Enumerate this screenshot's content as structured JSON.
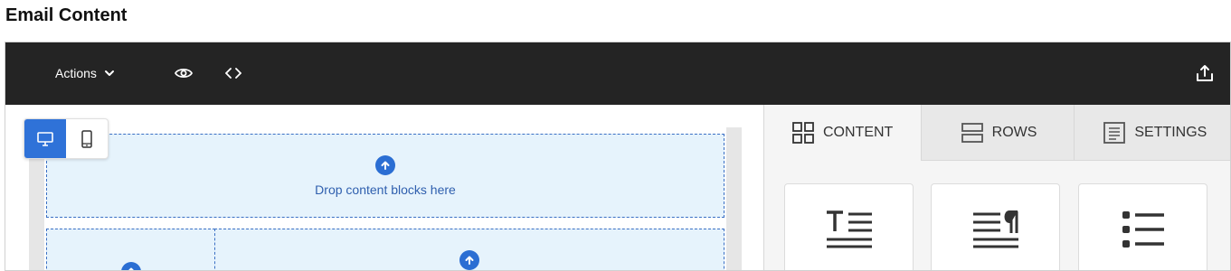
{
  "page": {
    "title": "Email Content"
  },
  "toolbar": {
    "actions_label": "Actions",
    "icons": [
      "chevron-down-icon",
      "eye-icon",
      "code-icon",
      "export-icon"
    ]
  },
  "device_toggle": {
    "active": "desktop",
    "options": [
      "desktop-icon",
      "mobile-icon"
    ]
  },
  "canvas": {
    "dropzone_text": "Drop content blocks here"
  },
  "panel": {
    "tabs": [
      {
        "label": "CONTENT",
        "icon": "grid-icon",
        "active": true
      },
      {
        "label": "ROWS",
        "icon": "rows-icon",
        "active": false
      },
      {
        "label": "SETTINGS",
        "icon": "settings-doc-icon",
        "active": false
      }
    ],
    "blocks": [
      "title-block-icon",
      "paragraph-block-icon",
      "list-block-icon"
    ]
  },
  "colors": {
    "toolbar_bg": "#242424",
    "accent": "#2f72d8",
    "dropzone_bg": "#e6f3fc",
    "dropzone_text": "#2f5fae"
  }
}
